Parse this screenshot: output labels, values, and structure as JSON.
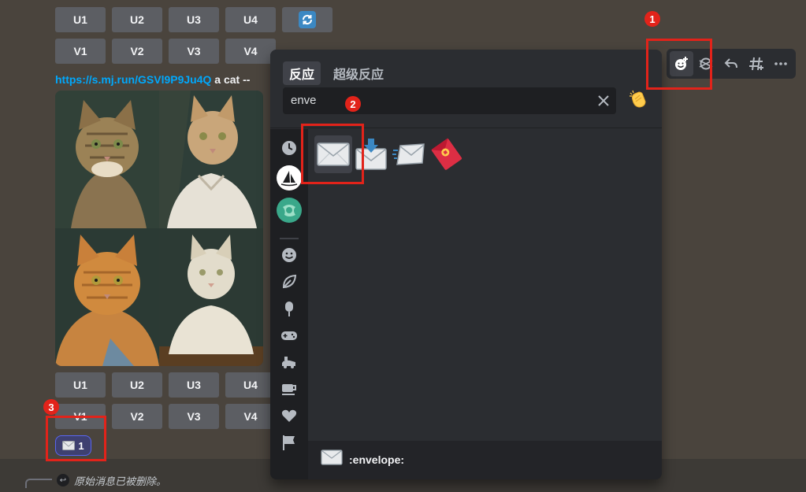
{
  "message_top": {
    "row1": [
      "U1",
      "U2",
      "U3",
      "U4"
    ],
    "row2": [
      "V1",
      "V2",
      "V3",
      "V4"
    ]
  },
  "message_link": {
    "url": "https://s.mj.run/GSVl9P9Ju4Q",
    "text": " a cat --"
  },
  "image_grid": {
    "cells": [
      "cat-tabby",
      "cat-cream",
      "cat-orange",
      "cat-white"
    ]
  },
  "message_bottom": {
    "row1": [
      "U1",
      "U2",
      "U3",
      "U4"
    ],
    "row2": [
      "V1",
      "V2",
      "V3",
      "V4"
    ]
  },
  "reaction": {
    "emoji": "envelope-icon",
    "count": "1"
  },
  "reply": {
    "text": "原始消息已被删除。"
  },
  "toolbar": {
    "buttons": [
      "add-reaction-icon",
      "super-reaction-icon",
      "reply-icon",
      "create-thread-icon",
      "more-icon"
    ]
  },
  "picker": {
    "tabs": {
      "reactions": "反应",
      "super_reactions": "超级反应"
    },
    "search": {
      "value": "enve"
    },
    "sidebar": [
      "clock-icon",
      "midjourney-server-icon",
      "server-globe-icon",
      "smile-icon",
      "leaf-icon",
      "popsicle-icon",
      "gamepad-icon",
      "car-icon",
      "coffee-icon",
      "heart-icon",
      "flag-icon"
    ],
    "results": [
      "envelope",
      "envelope_with_arrow",
      "incoming_envelope",
      "red_envelope"
    ],
    "footer": {
      "name": ":envelope:"
    }
  },
  "annotations": [
    "1",
    "2",
    "3"
  ],
  "colors": {
    "highlight": "#e2231a",
    "link": "#00a8fc",
    "blurple": "#5865f2"
  }
}
